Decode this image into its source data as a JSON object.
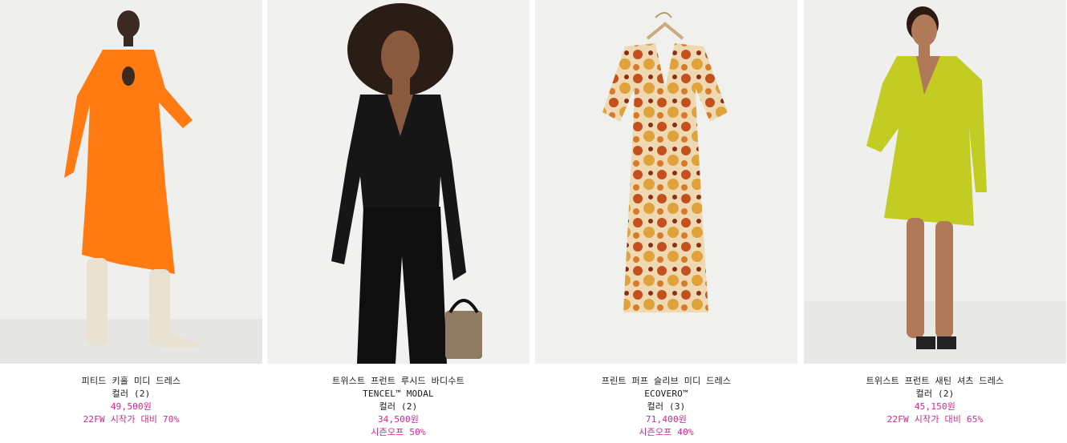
{
  "accent_color": "#e0208a",
  "products": [
    {
      "name": "피티드 키홀 미디 드레스",
      "subtitle": "",
      "colors": "컬러 (2)",
      "price": "49,500원",
      "promo": "22FW 시작가 대비 70%",
      "image": "orange keyhole midi dress"
    },
    {
      "name": "트위스트 프런트 루시드 바디수트",
      "subtitle": "TENCEL™ MODAL",
      "colors": "컬러 (2)",
      "price": "34,500원",
      "promo": "시즌오프 50%",
      "image": "black ruched bodysuit"
    },
    {
      "name": "프린트 퍼프 슬리브 미디 드레스",
      "subtitle": "ECOVERO™",
      "colors": "컬러 (3)",
      "price": "71,400원",
      "promo": "시즌오프 40%",
      "image": "floral puff sleeve dress"
    },
    {
      "name": "트위스트 프런트 새틴 셔츠 드레스",
      "subtitle": "",
      "colors": "컬러 (2)",
      "price": "45,150원",
      "promo": "22FW 시작가 대비 65%",
      "image": "lime satin shirt dress"
    }
  ]
}
